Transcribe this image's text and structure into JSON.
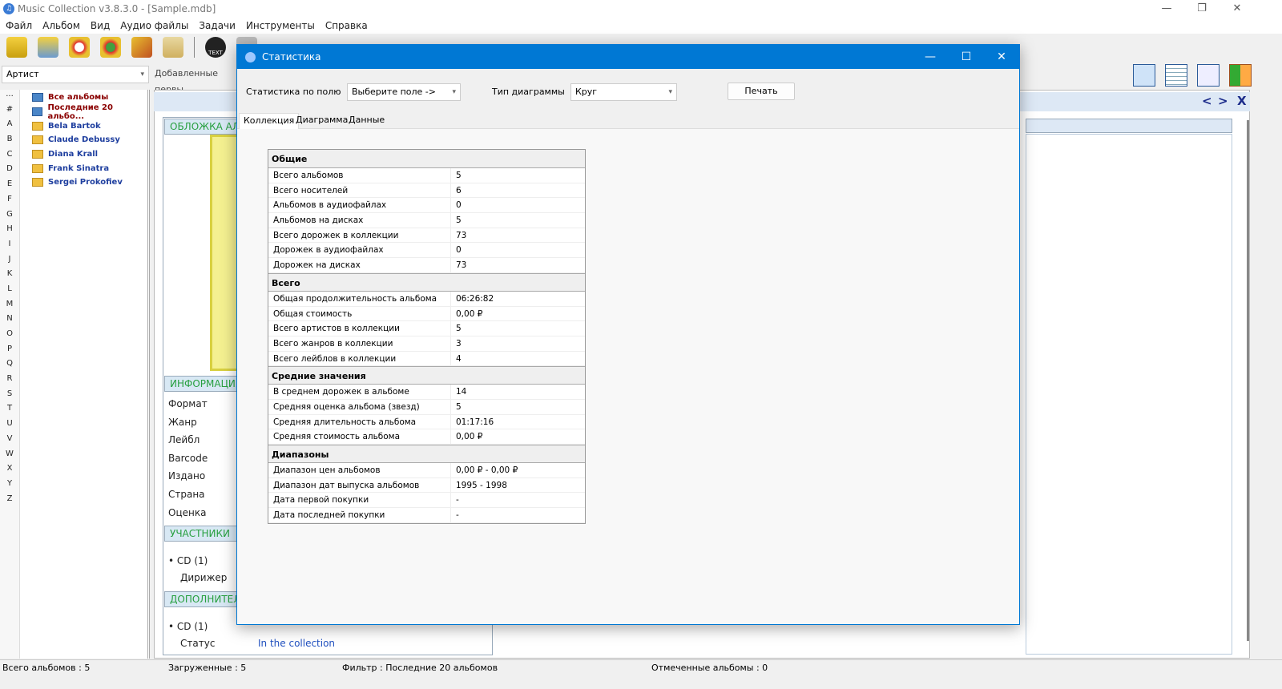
{
  "window": {
    "title": "Music Collection v3.8.3.0 - [Sample.mdb]"
  },
  "menu": [
    "Файл",
    "Альбом",
    "Вид",
    "Аудио файлы",
    "Задачи",
    "Инструменты",
    "Справка"
  ],
  "toolbar": {
    "text_button": "TEXT"
  },
  "filter": {
    "field_value": "Артист",
    "group_value": "Добавленные первы"
  },
  "alphabet": [
    "...",
    "#",
    "A",
    "B",
    "C",
    "D",
    "E",
    "F",
    "G",
    "H",
    "I",
    "J",
    "K",
    "L",
    "M",
    "N",
    "O",
    "P",
    "Q",
    "R",
    "S",
    "T",
    "U",
    "V",
    "W",
    "X",
    "Y",
    "Z"
  ],
  "tree": [
    {
      "label": "Все альбомы",
      "type": "special"
    },
    {
      "label": "Последние 20 альбо...",
      "type": "special"
    },
    {
      "label": "Bela Bartok",
      "type": "folder"
    },
    {
      "label": "Claude Debussy",
      "type": "folder"
    },
    {
      "label": "Diana Krall",
      "type": "folder"
    },
    {
      "label": "Frank Sinatra",
      "type": "folder"
    },
    {
      "label": "Sergei Prokofiev",
      "type": "folder"
    }
  ],
  "details": {
    "cover_header": "ОБЛОЖКА АЛЬБОМА",
    "info_header": "ИНФОРМАЦИЯ",
    "info_labels": [
      "Формат",
      "Жанр",
      "Лейбл",
      "Barcode",
      "Издано",
      "Страна",
      "Оценка"
    ],
    "participants_header": "УЧАСТНИКИ",
    "participants_disc": "CD (1)",
    "participants_role": "Дирижер",
    "extra_header": "ДОПОЛНИТЕЛЬНО",
    "extra_disc": "CD (1)",
    "status_label": "Статус",
    "status_value": "In the collection"
  },
  "nav": {
    "prev": "<",
    "next": ">",
    "close": "X"
  },
  "statusbar": {
    "total": "Всего альбомов : 5",
    "loaded": "Загруженные : 5",
    "filter": "Фильтр : Последние 20 альбомов",
    "marked": "Отмеченные альбомы : 0"
  },
  "dialog": {
    "title": "Статистика",
    "field_label": "Статистика по полю",
    "field_value": "Выберите поле ->",
    "chart_type_label": "Тип диаграммы",
    "chart_type_value": "Круг",
    "print_button": "Печать",
    "tabs": [
      "Коллекция",
      "Диаграмма",
      "Данные"
    ],
    "sections": [
      {
        "title": "Общие",
        "rows": [
          [
            "Всего альбомов",
            "5"
          ],
          [
            "Всего носителей",
            "6"
          ],
          [
            "Альбомов в аудиофайлах",
            "0"
          ],
          [
            "Альбомов на дисках",
            "5"
          ],
          [
            "Всего дорожек в коллекции",
            "73"
          ],
          [
            "Дорожек в аудиофайлах",
            "0"
          ],
          [
            "Дорожек на дисках",
            "73"
          ]
        ]
      },
      {
        "title": "Всего",
        "rows": [
          [
            "Общая продолжительность альбома",
            "06:26:82"
          ],
          [
            "Общая стоимость",
            "0,00 ₽"
          ],
          [
            "Всего артистов в коллекции",
            "5"
          ],
          [
            "Всего жанров в коллекции",
            "3"
          ],
          [
            "Всего лейблов в коллекции",
            "4"
          ]
        ]
      },
      {
        "title": "Средние значения",
        "rows": [
          [
            "В среднем дорожек в альбоме",
            "14"
          ],
          [
            "Средняя оценка альбома (звезд)",
            "5"
          ],
          [
            "Средняя длительность альбома",
            "01:17:16"
          ],
          [
            "Средняя стоимость альбома",
            "0,00 ₽"
          ]
        ]
      },
      {
        "title": "Диапазоны",
        "rows": [
          [
            "Диапазон цен альбомов",
            "0,00 ₽  -  0,00 ₽"
          ],
          [
            "Диапазон дат выпуска альбомов",
            "1995  -  1998"
          ],
          [
            "Дата первой покупки",
            "-"
          ],
          [
            "Дата последней покупки",
            "-"
          ]
        ]
      }
    ]
  }
}
